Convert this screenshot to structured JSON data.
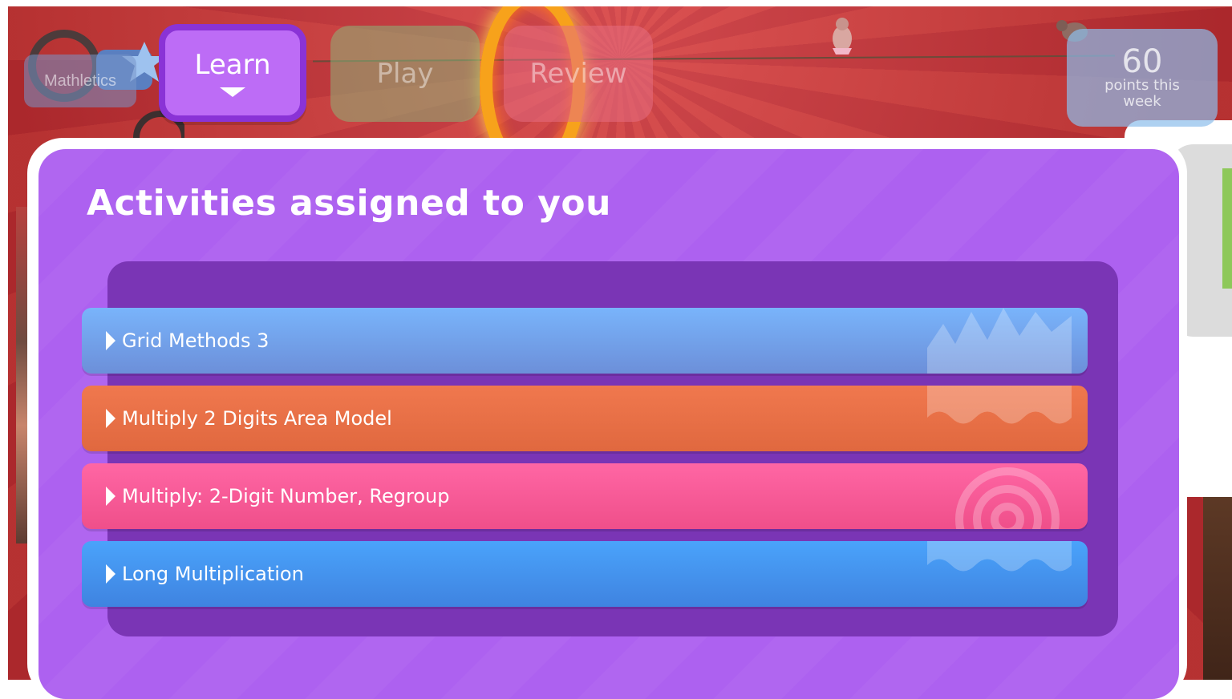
{
  "app": {
    "logo_text": "Mathletics"
  },
  "nav": {
    "tabs": [
      {
        "label": "Learn",
        "active": true
      },
      {
        "label": "Play",
        "active": false
      },
      {
        "label": "Review",
        "active": false
      }
    ],
    "points": {
      "value": "60",
      "label": "points this week"
    }
  },
  "main": {
    "title": "Activities assigned to you",
    "activities": [
      {
        "label": "Grid Methods 3",
        "color": "#79b4fb"
      },
      {
        "label": "Multiply 2 Digits Area Model",
        "color": "#f0784e"
      },
      {
        "label": "Multiply: 2-Digit Number, Regroup",
        "color": "#ff66a4"
      },
      {
        "label": "Long Multiplication",
        "color": "#4aa3fb"
      }
    ]
  },
  "icons": {
    "tab_caret": "chevron-down-icon",
    "activity_arrow": "play-arrow-icon"
  },
  "colors": {
    "panel_purple": "#ad61f0",
    "well_purple": "#7a35b5",
    "active_tab": "#bd6cf6"
  }
}
